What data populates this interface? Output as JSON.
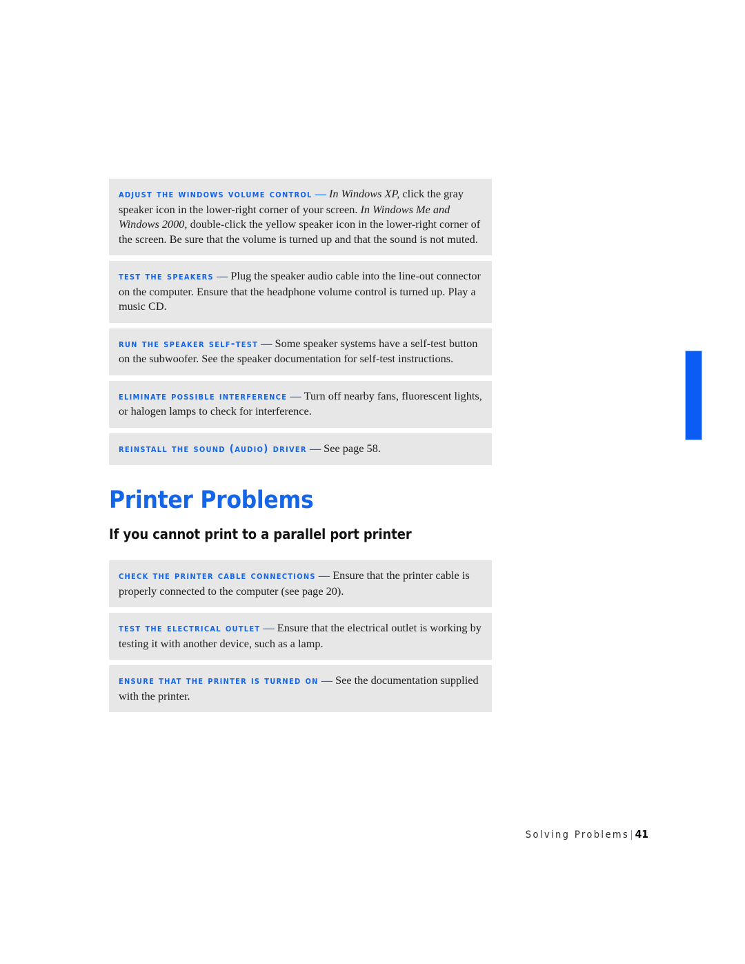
{
  "page": {
    "background_color": "#ffffff",
    "accent_color": "#1565e8",
    "tip_background_color": "#e7e7e7",
    "thumb_tab": {
      "color": "#0a5cf5",
      "name": "chapter-thumb-tab"
    }
  },
  "tips": [
    {
      "term": "Adjust the Windows volume control",
      "dash": "—",
      "body_parts": [
        {
          "text": "In Windows XP,",
          "italic": true
        },
        {
          "text": " click the gray speaker icon in the lower-right corner of your screen. ",
          "italic": false
        },
        {
          "text": "In Windows Me and Windows 2000,",
          "italic": true
        },
        {
          "text": " double-click the yellow speaker icon in the lower-right corner of the screen. Be sure that the volume is turned up and that the sound is not muted.",
          "italic": false
        }
      ]
    },
    {
      "term": "Test the speakers",
      "dash": "—",
      "body_parts": [
        {
          "text": "Plug the speaker audio cable into the line-out connector on the computer. Ensure that the headphone volume control is turned up. Play a music CD.",
          "italic": false
        }
      ]
    },
    {
      "term": "Run the speaker self-test",
      "dash": "—",
      "body_parts": [
        {
          "text": "Some speaker systems have a self-test button on the subwoofer. See the speaker documentation for self-test instructions.",
          "italic": false
        }
      ]
    },
    {
      "term": "Eliminate possible interference",
      "dash": "—",
      "body_parts": [
        {
          "text": "Turn off nearby fans, fluorescent lights, or halogen lamps to check for interference.",
          "italic": false
        }
      ]
    },
    {
      "term": "Reinstall the Sound (audio) driver",
      "dash": "—",
      "body_parts": [
        {
          "text": "See page 58.",
          "italic": false
        }
      ]
    }
  ],
  "section": {
    "title": "Printer Problems",
    "subtitle": "If you cannot print to a parallel port printer"
  },
  "printer_tips": [
    {
      "term": "Check the printer cable connections",
      "dash": "—",
      "body_parts": [
        {
          "text": "Ensure that the printer cable is properly connected to the computer (see page 20).",
          "italic": false
        }
      ]
    },
    {
      "term": "Test the electrical outlet",
      "dash": "—",
      "body_parts": [
        {
          "text": "Ensure that the electrical outlet is working by testing it with another device, such as a lamp.",
          "italic": false
        }
      ]
    },
    {
      "term": "Ensure that the printer is turned on",
      "dash": "—",
      "body_parts": [
        {
          "text": "See the documentation supplied with the printer.",
          "italic": false
        }
      ]
    }
  ],
  "footer": {
    "chapter": "Solving Problems",
    "separator": "|",
    "page_number": "41"
  }
}
